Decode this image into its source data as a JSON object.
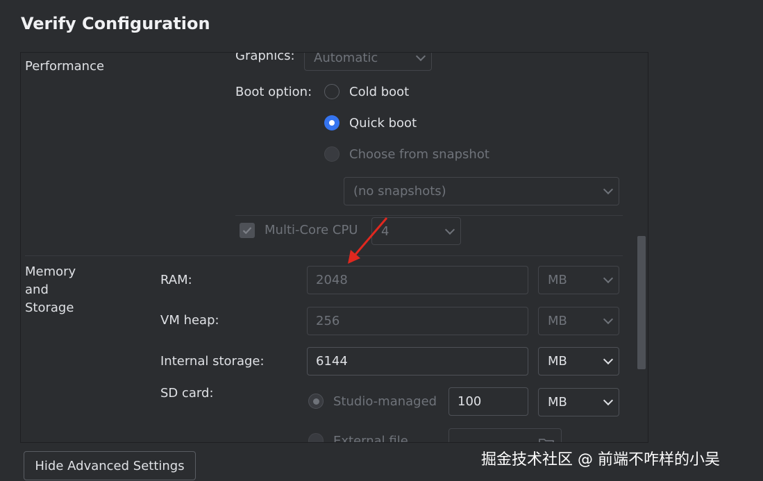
{
  "title": "Verify Configuration",
  "performance": {
    "section_label": "Performance",
    "graphics": {
      "label": "Graphics:",
      "value": "Automatic"
    },
    "boot": {
      "label": "Boot option:",
      "options": [
        {
          "label": "Cold boot",
          "state": "unchecked"
        },
        {
          "label": "Quick boot",
          "state": "checked"
        },
        {
          "label": "Choose from snapshot",
          "state": "disabled"
        }
      ],
      "snapshot_value": "(no snapshots)"
    },
    "multicore": {
      "label": "Multi-Core CPU",
      "checked": true,
      "value": "4"
    }
  },
  "memory": {
    "section_label_1": "Memory",
    "section_label_2": "and",
    "section_label_3": "Storage",
    "ram": {
      "label": "RAM:",
      "value": "2048",
      "unit": "MB"
    },
    "vm_heap": {
      "label": "VM heap:",
      "value": "256",
      "unit": "MB"
    },
    "internal": {
      "label": "Internal storage:",
      "value": "6144",
      "unit": "MB"
    },
    "sd": {
      "label": "SD card:",
      "studio_label": "Studio-managed",
      "studio_value": "100",
      "unit": "MB",
      "external_label": "External file"
    }
  },
  "hide_advanced_label": "Hide Advanced Settings",
  "watermark": "掘金技术社区 @ 前端不咋样的小吴",
  "colors": {
    "accent": "#3574f0",
    "arrow": "#e0281f",
    "background": "#2b2d30"
  }
}
